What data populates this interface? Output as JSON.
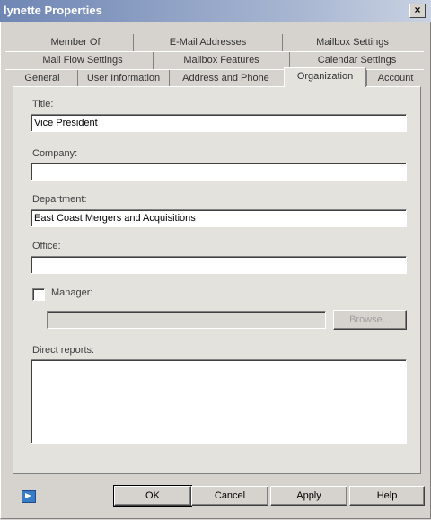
{
  "window": {
    "title": "lynette Properties",
    "close_glyph": "×"
  },
  "tabs": {
    "row1": [
      "Member Of",
      "E-Mail Addresses",
      "Mailbox Settings"
    ],
    "row2": [
      "Mail Flow Settings",
      "Mailbox Features",
      "Calendar Settings"
    ],
    "row3": [
      "General",
      "User Information",
      "Address and Phone",
      "Organization",
      "Account"
    ],
    "active": "Organization"
  },
  "form": {
    "title_label": "Title:",
    "title_value": "Vice President",
    "company_label": "Company:",
    "company_value": "",
    "department_label": "Department:",
    "department_value": "East Coast Mergers and Acquisitions",
    "office_label": "Office:",
    "office_value": "",
    "manager_label": "Manager:",
    "manager_checked": false,
    "manager_value": "",
    "browse_label": "Browse...",
    "direct_reports_label": "Direct reports:"
  },
  "footer": {
    "ok_label": "OK",
    "cancel_label": "Cancel",
    "apply_label": "Apply",
    "help_label": "Help",
    "help_icon": "help-icon"
  }
}
